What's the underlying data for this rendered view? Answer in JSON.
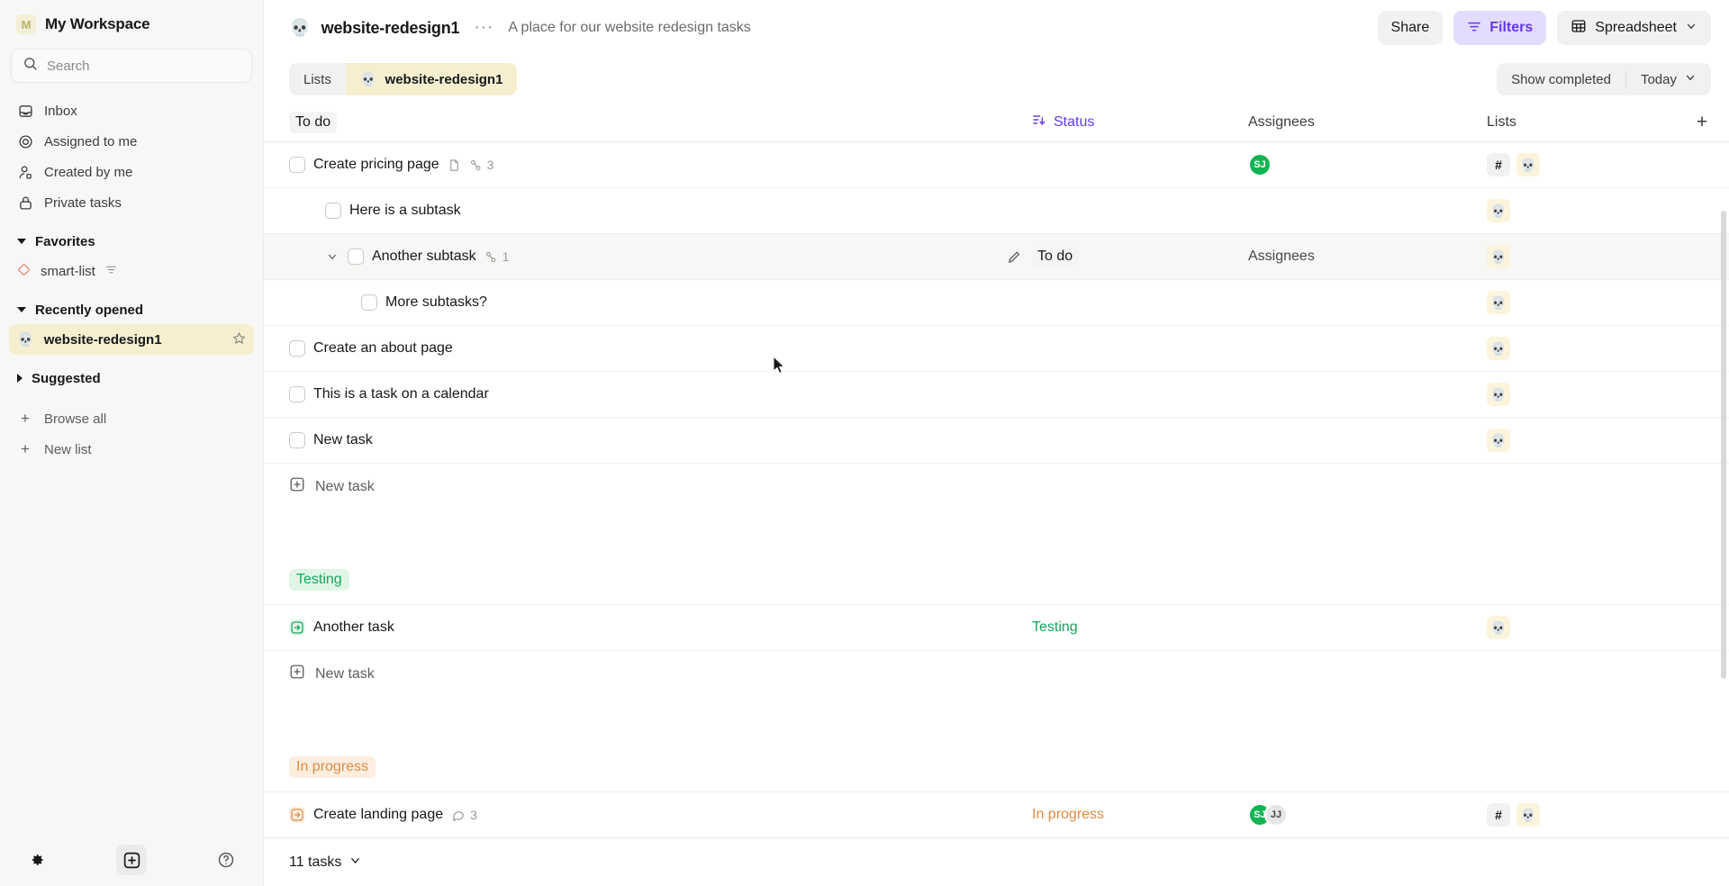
{
  "sidebar": {
    "workspace": {
      "initial": "M",
      "name": "My Workspace"
    },
    "search": {
      "placeholder": "Search",
      "value": "",
      "icon": "search-icon"
    },
    "nav": [
      {
        "label": "Inbox",
        "icon": "inbox-icon"
      },
      {
        "label": "Assigned to me",
        "icon": "target-icon"
      },
      {
        "label": "Created by me",
        "icon": "user-group-icon"
      },
      {
        "label": "Private tasks",
        "icon": "lock-icon"
      }
    ],
    "favorites": {
      "label": "Favorites",
      "expanded": true,
      "items": [
        {
          "label": "smart-list",
          "icon": "diamond-icon",
          "badge_icon": "filter-icon"
        }
      ]
    },
    "recently_opened": {
      "label": "Recently opened",
      "expanded": true,
      "items": [
        {
          "label": "website-redesign1",
          "emoji": "💀",
          "active": true,
          "star_icon": "star-icon"
        }
      ]
    },
    "suggested": {
      "label": "Suggested",
      "expanded": false
    },
    "actions": [
      {
        "label": "Browse all",
        "icon": "plus-icon"
      },
      {
        "label": "New list",
        "icon": "plus-icon"
      }
    ],
    "footer": [
      {
        "name": "settings-button",
        "icon": "gear-icon"
      },
      {
        "name": "new-button",
        "icon": "plus-square-icon"
      },
      {
        "name": "help-button",
        "icon": "question-circle-icon"
      }
    ]
  },
  "topbar": {
    "emoji": "💀",
    "title": "website-redesign1",
    "more": "···",
    "subtitle": "A place for our website redesign tasks",
    "share_label": "Share",
    "filters_label": "Filters",
    "view_label": "Spreadsheet",
    "view_chevron": "∨"
  },
  "tabbar": {
    "tabs": [
      {
        "label": "Lists",
        "selected": false
      },
      {
        "label": "website-redesign1",
        "emoji": "💀",
        "selected": true
      }
    ],
    "show_completed": "Show completed",
    "date_filter": "Today",
    "date_chevron": "∨"
  },
  "table": {
    "columns": {
      "name": "To do",
      "status": "Status",
      "status_sorted": true,
      "assignees": "Assignees",
      "lists": "Lists",
      "add": "+"
    },
    "groups": [
      {
        "label": null,
        "rows": [
          {
            "title": "Create pricing page",
            "indent": 0,
            "checkbox": true,
            "doc_icon": true,
            "subtask_icon": true,
            "subtask_count": "3",
            "status": "",
            "assignees": [
              {
                "initials": "SJ",
                "color": "#12b452"
              }
            ],
            "lists": [
              "hash",
              "skull"
            ]
          },
          {
            "title": "Here is a subtask",
            "indent": 1,
            "checkbox": true,
            "status": "",
            "assignees": [],
            "lists": [
              "skull"
            ]
          },
          {
            "title": "Another subtask",
            "indent": 1,
            "checkbox": true,
            "disclosure": "∨",
            "subtask_icon": true,
            "subtask_count": "1",
            "hovered": true,
            "edit_icon": true,
            "status": "To do",
            "status_kind": "todo",
            "assignees_placeholder": "Assignees",
            "assignees": [],
            "lists": [
              "skull"
            ]
          },
          {
            "title": "More subtasks?",
            "indent": 2,
            "checkbox": true,
            "status": "",
            "assignees": [],
            "lists": [
              "skull"
            ]
          },
          {
            "title": "Create an about page",
            "indent": 0,
            "checkbox": true,
            "status": "",
            "assignees": [],
            "lists": [
              "skull"
            ]
          },
          {
            "title": "This is a task on a calendar",
            "indent": 0,
            "checkbox": true,
            "status": "",
            "assignees": [],
            "lists": [
              "skull"
            ]
          },
          {
            "title": "New task",
            "indent": 0,
            "checkbox": true,
            "status": "",
            "assignees": [],
            "lists": [
              "skull"
            ]
          }
        ],
        "new_task_label": "New task"
      },
      {
        "label": "Testing",
        "label_kind": "testing",
        "rows": [
          {
            "title": "Another task",
            "indent": 0,
            "status_arrow": "green",
            "status": "Testing",
            "status_kind": "testing",
            "assignees": [],
            "lists": [
              "skull"
            ]
          }
        ],
        "new_task_label": "New task"
      },
      {
        "label": "In progress",
        "label_kind": "inprog",
        "rows": [
          {
            "title": "Create landing page",
            "indent": 0,
            "status_arrow": "orange",
            "comment_icon": true,
            "comment_count": "3",
            "status": "In progress",
            "status_kind": "inprog",
            "assignees": [
              {
                "initials": "SJ",
                "color": "#12b452"
              },
              {
                "initials": "JJ",
                "color": "#e6e6e4"
              }
            ],
            "lists": [
              "hash",
              "skull"
            ]
          }
        ]
      }
    ]
  },
  "footer": {
    "task_count": "11 tasks",
    "chevron": "∨"
  },
  "colors": {
    "accent_purple": "#6639e8",
    "filters_bg": "#e4dcff",
    "list_active_bg": "#f6efcf",
    "testing_green": "#14a85a",
    "testing_bg": "#dff6e7",
    "inprogress_orange": "#e08b45",
    "inprogress_bg": "#fceedf",
    "avatar_green": "#12b452"
  }
}
